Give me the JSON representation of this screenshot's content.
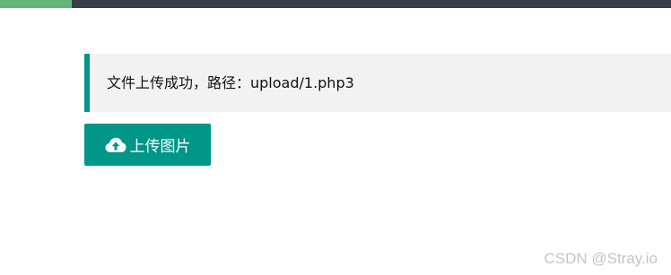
{
  "header": {
    "accent_color": "#5fb878",
    "bar_color": "#393d49"
  },
  "notice": {
    "text": "文件上传成功，路径：upload/1.php3",
    "border_color": "#009688"
  },
  "upload_button": {
    "label": "上传图片",
    "icon": "cloud-upload-icon",
    "color": "#009688"
  },
  "watermark": {
    "text": "CSDN @Stray.io"
  }
}
